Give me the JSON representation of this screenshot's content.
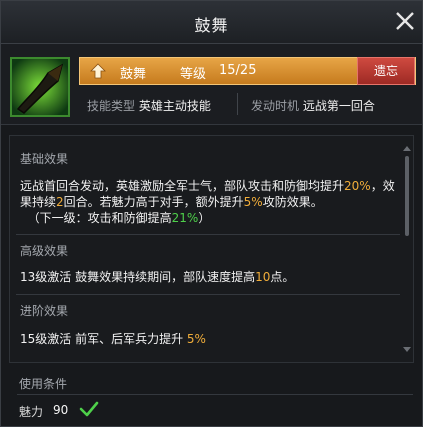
{
  "window": {
    "title": "鼓舞"
  },
  "skill": {
    "icon": "horn-icon",
    "name": "鼓舞",
    "level_label": "等级",
    "level_value": "15/25",
    "forget_label": "遗忘",
    "type_label": "技能类型",
    "type_value": "英雄主动技能",
    "trigger_label": "发动时机",
    "trigger_value": "远战第一回合"
  },
  "effects": {
    "basic": {
      "title": "基础效果",
      "p1_a": "远战首回合发动，英雄激励全军士气，部队攻击和防御均提升",
      "p1_hl1": "20%",
      "p1_b": "，效果持续",
      "p1_hl2": "2",
      "p1_c": "回合。若魅力高于对手，额外提升",
      "p1_hl3": "5%",
      "p1_d": "攻防效果。",
      "next_a": "（下一级：攻击和防御提高",
      "next_hl": "21%",
      "next_b": "）"
    },
    "advanced": {
      "title": "高级效果",
      "a": "13级激活 鼓舞效果持续期间，部队速度提高",
      "hl": "10",
      "b": "点。"
    },
    "upgrade": {
      "title": "进阶效果",
      "a": "15级激活  前军、后军兵力提升 ",
      "hl": "5%"
    }
  },
  "conditions": {
    "title": "使用条件",
    "stat_label": "魅力",
    "stat_value": "90",
    "status_icon": "check-icon"
  },
  "colors": {
    "highlight": "#f0ad3a",
    "highlight_green": "#4ed04a",
    "name_bar": "#d88f31",
    "forget_button": "#b5362f"
  }
}
